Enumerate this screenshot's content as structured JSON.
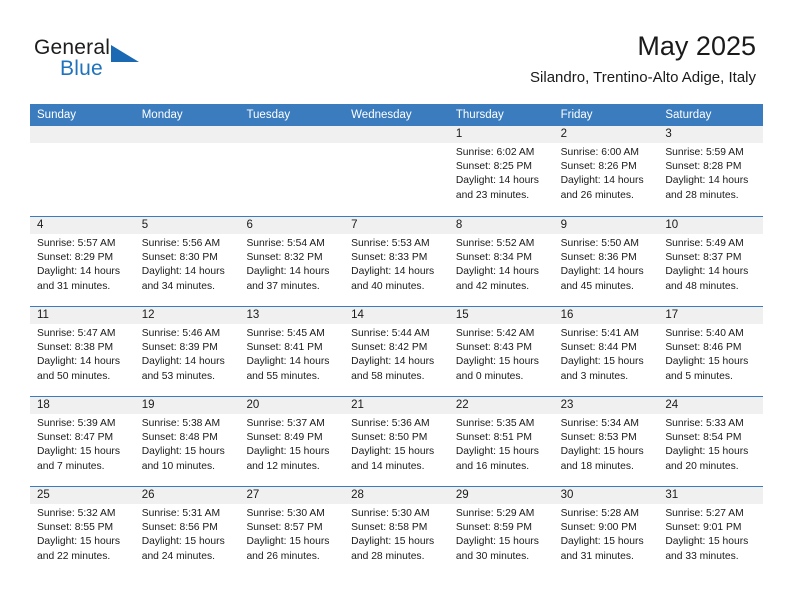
{
  "brand": {
    "name_top": "General",
    "name_bottom": "Blue",
    "accent_color": "#1b69b3"
  },
  "header": {
    "title": "May 2025",
    "subtitle": "Silandro, Trentino-Alto Adige, Italy",
    "header_bg": "#3a7cbe",
    "band_bg": "#f0f0f0"
  },
  "weekdays": [
    "Sunday",
    "Monday",
    "Tuesday",
    "Wednesday",
    "Thursday",
    "Friday",
    "Saturday"
  ],
  "weeks": [
    [
      {
        "empty": true
      },
      {
        "empty": true
      },
      {
        "empty": true
      },
      {
        "empty": true
      },
      {
        "day": "1",
        "sunrise": "Sunrise: 6:02 AM",
        "sunset": "Sunset: 8:25 PM",
        "daylight1": "Daylight: 14 hours",
        "daylight2": "and 23 minutes."
      },
      {
        "day": "2",
        "sunrise": "Sunrise: 6:00 AM",
        "sunset": "Sunset: 8:26 PM",
        "daylight1": "Daylight: 14 hours",
        "daylight2": "and 26 minutes."
      },
      {
        "day": "3",
        "sunrise": "Sunrise: 5:59 AM",
        "sunset": "Sunset: 8:28 PM",
        "daylight1": "Daylight: 14 hours",
        "daylight2": "and 28 minutes."
      }
    ],
    [
      {
        "day": "4",
        "sunrise": "Sunrise: 5:57 AM",
        "sunset": "Sunset: 8:29 PM",
        "daylight1": "Daylight: 14 hours",
        "daylight2": "and 31 minutes."
      },
      {
        "day": "5",
        "sunrise": "Sunrise: 5:56 AM",
        "sunset": "Sunset: 8:30 PM",
        "daylight1": "Daylight: 14 hours",
        "daylight2": "and 34 minutes."
      },
      {
        "day": "6",
        "sunrise": "Sunrise: 5:54 AM",
        "sunset": "Sunset: 8:32 PM",
        "daylight1": "Daylight: 14 hours",
        "daylight2": "and 37 minutes."
      },
      {
        "day": "7",
        "sunrise": "Sunrise: 5:53 AM",
        "sunset": "Sunset: 8:33 PM",
        "daylight1": "Daylight: 14 hours",
        "daylight2": "and 40 minutes."
      },
      {
        "day": "8",
        "sunrise": "Sunrise: 5:52 AM",
        "sunset": "Sunset: 8:34 PM",
        "daylight1": "Daylight: 14 hours",
        "daylight2": "and 42 minutes."
      },
      {
        "day": "9",
        "sunrise": "Sunrise: 5:50 AM",
        "sunset": "Sunset: 8:36 PM",
        "daylight1": "Daylight: 14 hours",
        "daylight2": "and 45 minutes."
      },
      {
        "day": "10",
        "sunrise": "Sunrise: 5:49 AM",
        "sunset": "Sunset: 8:37 PM",
        "daylight1": "Daylight: 14 hours",
        "daylight2": "and 48 minutes."
      }
    ],
    [
      {
        "day": "11",
        "sunrise": "Sunrise: 5:47 AM",
        "sunset": "Sunset: 8:38 PM",
        "daylight1": "Daylight: 14 hours",
        "daylight2": "and 50 minutes."
      },
      {
        "day": "12",
        "sunrise": "Sunrise: 5:46 AM",
        "sunset": "Sunset: 8:39 PM",
        "daylight1": "Daylight: 14 hours",
        "daylight2": "and 53 minutes."
      },
      {
        "day": "13",
        "sunrise": "Sunrise: 5:45 AM",
        "sunset": "Sunset: 8:41 PM",
        "daylight1": "Daylight: 14 hours",
        "daylight2": "and 55 minutes."
      },
      {
        "day": "14",
        "sunrise": "Sunrise: 5:44 AM",
        "sunset": "Sunset: 8:42 PM",
        "daylight1": "Daylight: 14 hours",
        "daylight2": "and 58 minutes."
      },
      {
        "day": "15",
        "sunrise": "Sunrise: 5:42 AM",
        "sunset": "Sunset: 8:43 PM",
        "daylight1": "Daylight: 15 hours",
        "daylight2": "and 0 minutes."
      },
      {
        "day": "16",
        "sunrise": "Sunrise: 5:41 AM",
        "sunset": "Sunset: 8:44 PM",
        "daylight1": "Daylight: 15 hours",
        "daylight2": "and 3 minutes."
      },
      {
        "day": "17",
        "sunrise": "Sunrise: 5:40 AM",
        "sunset": "Sunset: 8:46 PM",
        "daylight1": "Daylight: 15 hours",
        "daylight2": "and 5 minutes."
      }
    ],
    [
      {
        "day": "18",
        "sunrise": "Sunrise: 5:39 AM",
        "sunset": "Sunset: 8:47 PM",
        "daylight1": "Daylight: 15 hours",
        "daylight2": "and 7 minutes."
      },
      {
        "day": "19",
        "sunrise": "Sunrise: 5:38 AM",
        "sunset": "Sunset: 8:48 PM",
        "daylight1": "Daylight: 15 hours",
        "daylight2": "and 10 minutes."
      },
      {
        "day": "20",
        "sunrise": "Sunrise: 5:37 AM",
        "sunset": "Sunset: 8:49 PM",
        "daylight1": "Daylight: 15 hours",
        "daylight2": "and 12 minutes."
      },
      {
        "day": "21",
        "sunrise": "Sunrise: 5:36 AM",
        "sunset": "Sunset: 8:50 PM",
        "daylight1": "Daylight: 15 hours",
        "daylight2": "and 14 minutes."
      },
      {
        "day": "22",
        "sunrise": "Sunrise: 5:35 AM",
        "sunset": "Sunset: 8:51 PM",
        "daylight1": "Daylight: 15 hours",
        "daylight2": "and 16 minutes."
      },
      {
        "day": "23",
        "sunrise": "Sunrise: 5:34 AM",
        "sunset": "Sunset: 8:53 PM",
        "daylight1": "Daylight: 15 hours",
        "daylight2": "and 18 minutes."
      },
      {
        "day": "24",
        "sunrise": "Sunrise: 5:33 AM",
        "sunset": "Sunset: 8:54 PM",
        "daylight1": "Daylight: 15 hours",
        "daylight2": "and 20 minutes."
      }
    ],
    [
      {
        "day": "25",
        "sunrise": "Sunrise: 5:32 AM",
        "sunset": "Sunset: 8:55 PM",
        "daylight1": "Daylight: 15 hours",
        "daylight2": "and 22 minutes."
      },
      {
        "day": "26",
        "sunrise": "Sunrise: 5:31 AM",
        "sunset": "Sunset: 8:56 PM",
        "daylight1": "Daylight: 15 hours",
        "daylight2": "and 24 minutes."
      },
      {
        "day": "27",
        "sunrise": "Sunrise: 5:30 AM",
        "sunset": "Sunset: 8:57 PM",
        "daylight1": "Daylight: 15 hours",
        "daylight2": "and 26 minutes."
      },
      {
        "day": "28",
        "sunrise": "Sunrise: 5:30 AM",
        "sunset": "Sunset: 8:58 PM",
        "daylight1": "Daylight: 15 hours",
        "daylight2": "and 28 minutes."
      },
      {
        "day": "29",
        "sunrise": "Sunrise: 5:29 AM",
        "sunset": "Sunset: 8:59 PM",
        "daylight1": "Daylight: 15 hours",
        "daylight2": "and 30 minutes."
      },
      {
        "day": "30",
        "sunrise": "Sunrise: 5:28 AM",
        "sunset": "Sunset: 9:00 PM",
        "daylight1": "Daylight: 15 hours",
        "daylight2": "and 31 minutes."
      },
      {
        "day": "31",
        "sunrise": "Sunrise: 5:27 AM",
        "sunset": "Sunset: 9:01 PM",
        "daylight1": "Daylight: 15 hours",
        "daylight2": "and 33 minutes."
      }
    ]
  ]
}
